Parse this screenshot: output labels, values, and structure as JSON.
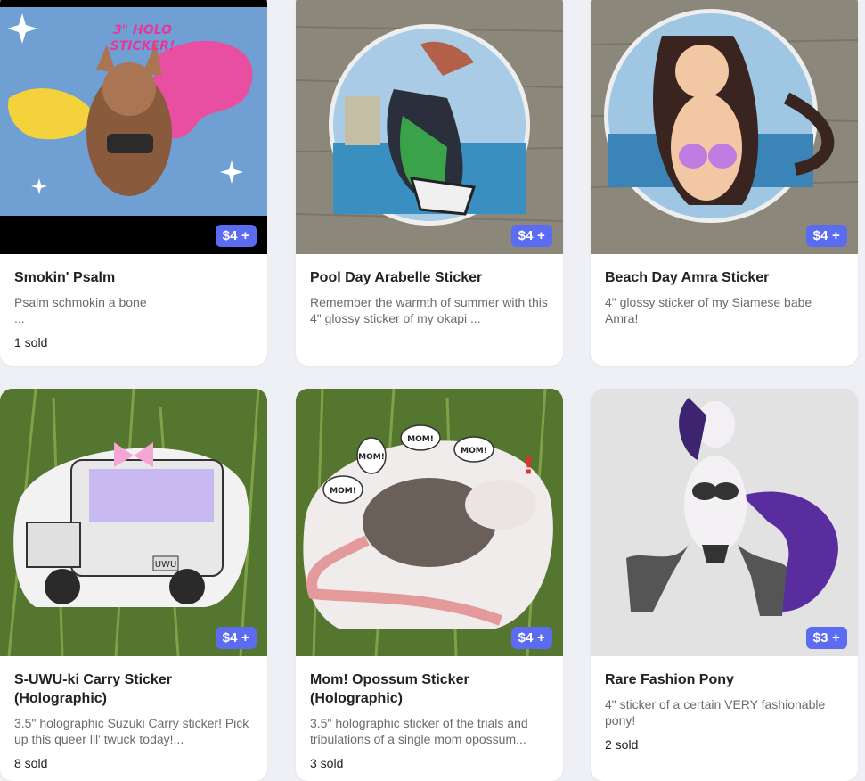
{
  "products": [
    {
      "title": "Smokin' Psalm",
      "description": "Psalm schmokin a bone\n...",
      "price": "$4 +",
      "sold": "1 sold",
      "image_text": "3\" HOLO STICKER!"
    },
    {
      "title": "Pool Day Arabelle Sticker",
      "description": "Remember the warmth of summer with this 4\" glossy sticker of my okapi ...",
      "price": "$4 +",
      "sold": ""
    },
    {
      "title": "Beach Day Amra Sticker",
      "description": "4\" glossy sticker of my Siamese babe Amra!",
      "price": "$4 +",
      "sold": ""
    },
    {
      "title": "S-UWU-ki Carry Sticker (Holographic)",
      "description": "3.5\" holographic Suzuki Carry sticker! Pick up this queer lil' twuck today!...",
      "price": "$4 +",
      "sold": "8 sold",
      "image_text": "UWU"
    },
    {
      "title": "Mom! Opossum Sticker (Holographic)",
      "description": "3.5\" holographic sticker of the trials and tribulations of a single mom opossum...",
      "price": "$4 +",
      "sold": "3 sold",
      "image_bubbles": [
        "MOM!",
        "MOM!",
        "MOM!",
        "MOM!"
      ]
    },
    {
      "title": "Rare Fashion Pony",
      "description": "4\" sticker of a certain VERY fashionable pony!",
      "price": "$3 +",
      "sold": "2 sold"
    }
  ],
  "colors": {
    "price_badge": "#5b6cf0",
    "page_background": "#eef0f5"
  }
}
